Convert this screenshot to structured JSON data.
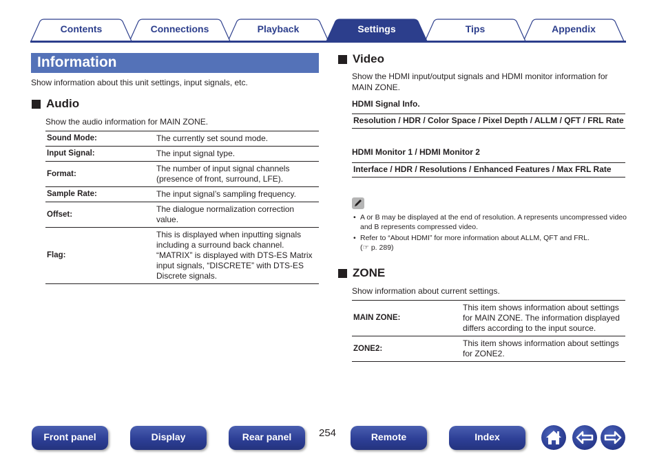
{
  "tabs": [
    {
      "label": "Contents",
      "active": false
    },
    {
      "label": "Connections",
      "active": false
    },
    {
      "label": "Playback",
      "active": false
    },
    {
      "label": "Settings",
      "active": true
    },
    {
      "label": "Tips",
      "active": false
    },
    {
      "label": "Appendix",
      "active": false
    }
  ],
  "colors": {
    "brand": "#2c3e8c",
    "title_bar": "#5472b8",
    "text": "#231f20"
  },
  "page": {
    "title": "Information",
    "intro": "Show information about this unit settings, input signals, etc."
  },
  "audio": {
    "heading": "Audio",
    "description": "Show the audio information for MAIN ZONE.",
    "rows": [
      {
        "key": "Sound Mode:",
        "value": "The currently set sound mode."
      },
      {
        "key": "Input Signal:",
        "value": "The input signal type."
      },
      {
        "key": "Format:",
        "value": "The number of input signal channels (presence of front, surround, LFE)."
      },
      {
        "key": "Sample Rate:",
        "value": "The input signal’s sampling frequency."
      },
      {
        "key": "Offset:",
        "value": "The dialogue normalization correction value."
      },
      {
        "key": "Flag:",
        "value": "This is displayed when inputting signals including a surround back channel. “MATRIX” is displayed with DTS-ES Matrix input signals, “DISCRETE” with DTS-ES Discrete signals."
      }
    ]
  },
  "video": {
    "heading": "Video",
    "description": "Show the HDMI input/output signals and HDMI monitor information for MAIN ZONE.",
    "signal_info_label": "HDMI Signal Info.",
    "signal_info_items": "Resolution / HDR / Color Space / Pixel Depth / ALLM / QFT / FRL Rate",
    "monitor_label": "HDMI Monitor 1 / HDMI Monitor 2",
    "monitor_items": "Interface / HDR / Resolutions / Enhanced Features / Max FRL Rate",
    "notes": [
      "A or B may be displayed at the end of resolution. A represents uncompressed video and B represents compressed video.",
      "Refer to “About HDMI” for more information about ALLM, QFT and FRL."
    ],
    "note_ref": "p. 289"
  },
  "zone": {
    "heading": "ZONE",
    "description": "Show information about current settings.",
    "rows": [
      {
        "key": "MAIN ZONE:",
        "value": "This item shows information about settings for MAIN ZONE. The information displayed differs according to the input source."
      },
      {
        "key": "ZONE2:",
        "value": "This item shows information about settings for ZONE2."
      }
    ]
  },
  "bottom_nav": {
    "buttons": [
      "Front panel",
      "Display",
      "Rear panel",
      "Remote",
      "Index"
    ],
    "page_number": "254",
    "icons": [
      "home-icon",
      "back-arrow-icon",
      "forward-arrow-icon"
    ]
  }
}
